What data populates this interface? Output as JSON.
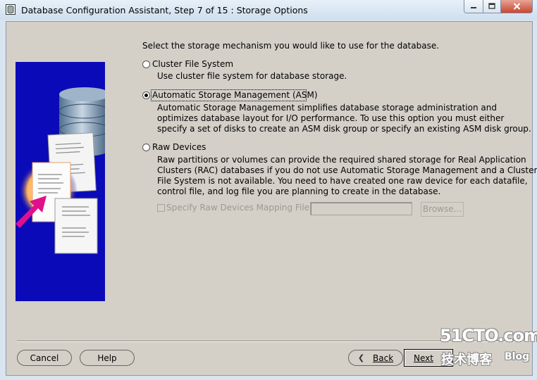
{
  "window": {
    "title": "Database Configuration Assistant, Step 7 of 15 : Storage Options"
  },
  "content": {
    "intro": "Select the storage mechanism you would like to use for the database.",
    "selected_option": "asm",
    "options": [
      {
        "id": "cfs",
        "label": "Cluster File System",
        "desc": [
          "Use cluster file system for database storage."
        ]
      },
      {
        "id": "asm",
        "label": "Automatic Storage Management (ASM)",
        "desc": [
          "Automatic Storage Management simplifies database storage administration and",
          "optimizes database layout for I/O performance. To use this option you must either",
          "specify a set of disks to create an ASM disk group or specify an existing ASM disk group."
        ]
      },
      {
        "id": "raw",
        "label": "Raw Devices",
        "desc": [
          "Raw partitions or volumes can provide the required shared storage for Real Application",
          "Clusters (RAC) databases if you do not use Automatic Storage Management and a Cluster",
          "File System is not available.  You need to have created one raw device for each datafile,",
          "control file, and log file you are planning to create in the database."
        ]
      }
    ],
    "raw_mapping": {
      "checkbox_label": "Specify Raw Devices Mapping File",
      "checked": false,
      "field_value": "",
      "browse_label": "Browse..."
    }
  },
  "footer": {
    "cancel": "Cancel",
    "help": "Help",
    "back": "Back",
    "next": "Next"
  },
  "watermark": {
    "site": "51CTO.com",
    "tagline": "技术博客",
    "blog": "Blog"
  },
  "colors": {
    "dialog_bg": "#d4d0c8",
    "illustration_bg": "#0a0ab8",
    "arrow": "#e0108c",
    "close_button": "#c7472f"
  }
}
